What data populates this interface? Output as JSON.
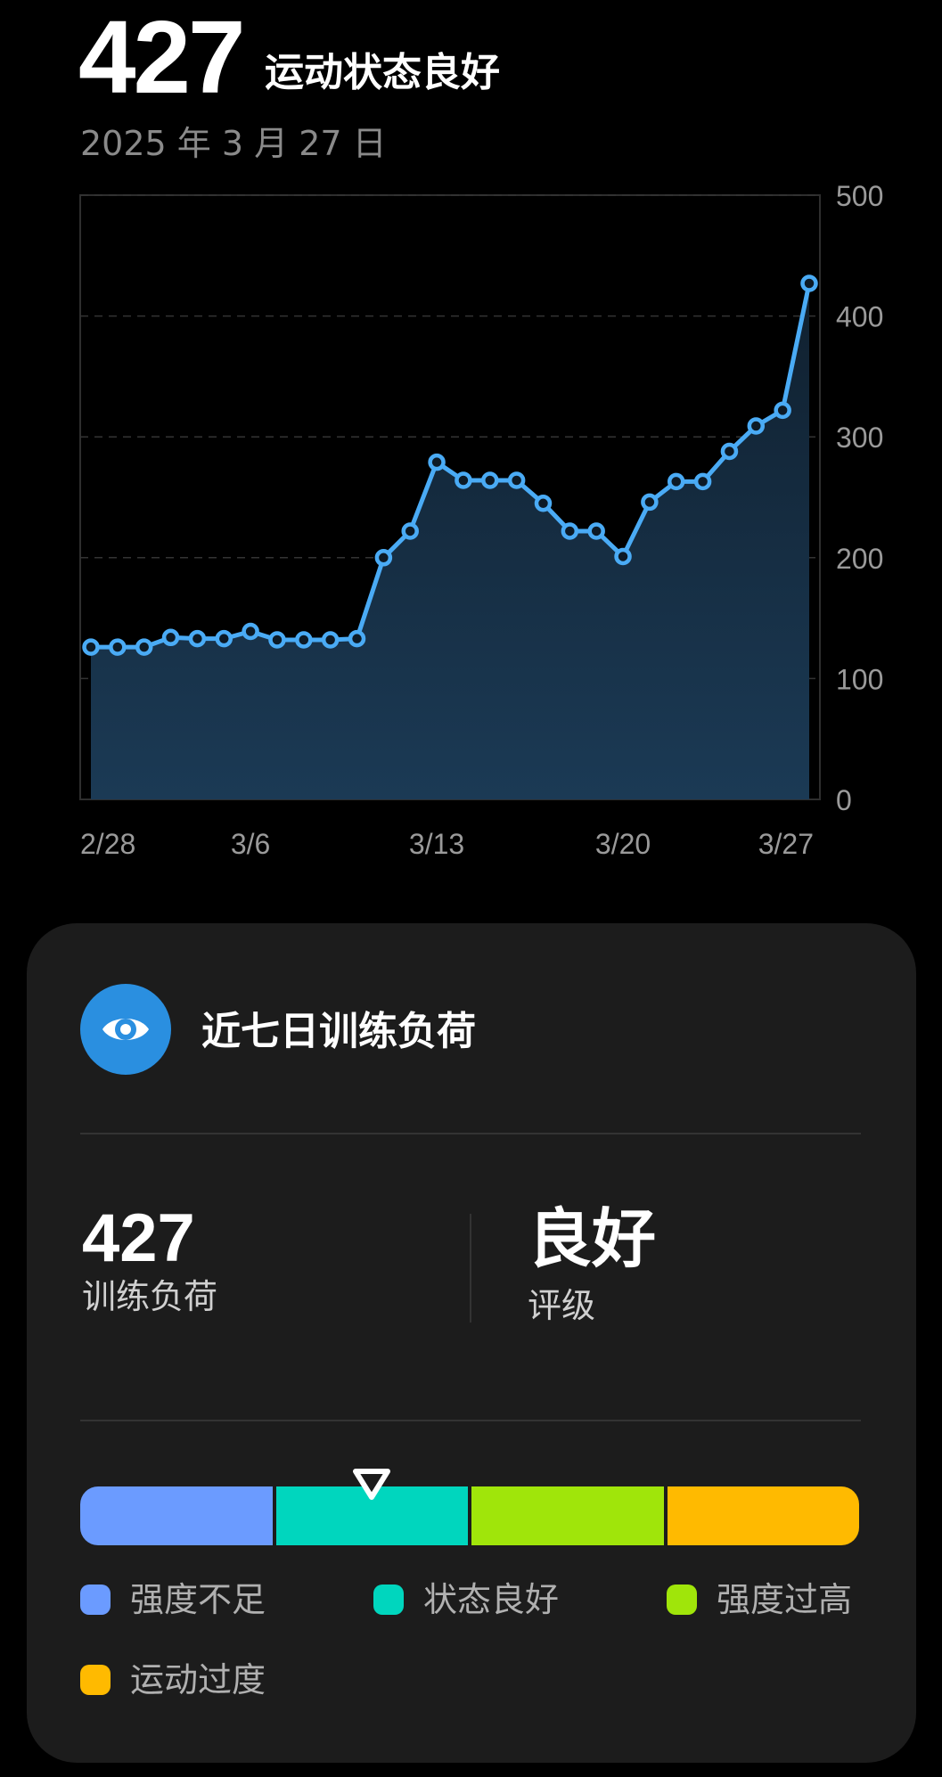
{
  "header": {
    "value": "427",
    "status": "运动状态良好",
    "date": "2025 年 3 月 27 日"
  },
  "chart_data": {
    "type": "line",
    "x": [
      "2/28",
      "3/1",
      "3/2",
      "3/3",
      "3/4",
      "3/5",
      "3/6",
      "3/7",
      "3/8",
      "3/9",
      "3/10",
      "3/11",
      "3/12",
      "3/13",
      "3/14",
      "3/15",
      "3/16",
      "3/17",
      "3/18",
      "3/19",
      "3/20",
      "3/21",
      "3/22",
      "3/23",
      "3/24",
      "3/25",
      "3/26",
      "3/27"
    ],
    "values": [
      126,
      126,
      126,
      134,
      133,
      133,
      139,
      132,
      132,
      132,
      133,
      200,
      222,
      279,
      264,
      264,
      264,
      245,
      222,
      222,
      201,
      246,
      263,
      263,
      288,
      309,
      322,
      427
    ],
    "x_tick_labels": [
      "2/28",
      "3/6",
      "3/13",
      "3/20",
      "3/27"
    ],
    "y_ticks": [
      0,
      100,
      200,
      300,
      400,
      500
    ],
    "ylim": [
      0,
      500
    ],
    "grid": true,
    "y_axis_position": "right",
    "line_color": "#4aabf5",
    "area_color": "#1b3a55"
  },
  "card": {
    "icon": "eye-icon",
    "title": "近七日训练负荷",
    "load_value": "427",
    "load_label": "训练负荷",
    "grade_value": "良好",
    "grade_label": "评级",
    "zones": [
      {
        "label": "强度不足",
        "color": "#6b9bff"
      },
      {
        "label": "状态良好",
        "color": "#00d6be"
      },
      {
        "label": "强度过高",
        "color": "#a0e50a"
      },
      {
        "label": "运动过度",
        "color": "#ffba00"
      }
    ],
    "marker_position": 0.374
  }
}
